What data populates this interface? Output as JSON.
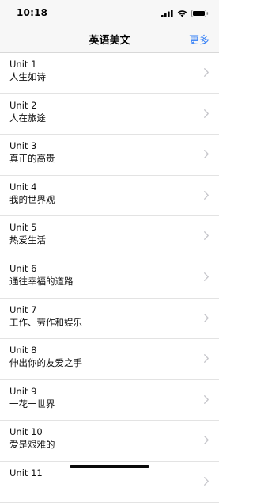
{
  "status_bar": {
    "time": "10:18",
    "icons": [
      "cellular-signal-icon",
      "wifi-icon",
      "battery-icon"
    ]
  },
  "nav": {
    "title": "英语美文",
    "more": "更多"
  },
  "colors": {
    "accent": "#2f7cf6",
    "bar_background": "#f7f7f7",
    "separator": "#e3e3e3",
    "chevron": "#c7c7cc"
  },
  "units": [
    {
      "title": "Unit 1",
      "subtitle": "人生如诗"
    },
    {
      "title": "Unit 2",
      "subtitle": "人在旅途"
    },
    {
      "title": "Unit 3",
      "subtitle": "真正的高贵"
    },
    {
      "title": "Unit 4",
      "subtitle": "我的世界观"
    },
    {
      "title": "Unit 5",
      "subtitle": "热爱生活"
    },
    {
      "title": "Unit 6",
      "subtitle": "通往幸福的道路"
    },
    {
      "title": "Unit 7",
      "subtitle": "工作、劳作和娱乐"
    },
    {
      "title": "Unit 8",
      "subtitle": "伸出你的友爱之手"
    },
    {
      "title": "Unit 9",
      "subtitle": "一花一世界"
    },
    {
      "title": "Unit 10",
      "subtitle": "爱是艰难的"
    },
    {
      "title": "Unit 11",
      "subtitle": ""
    }
  ]
}
